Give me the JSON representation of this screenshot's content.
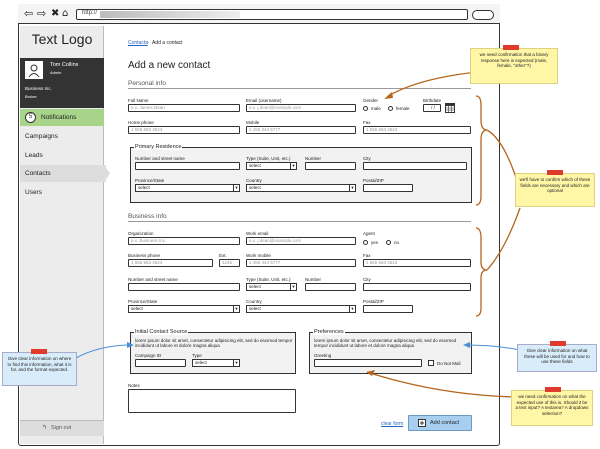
{
  "browser": {
    "url_prefix": "http://"
  },
  "sidebar": {
    "logo": "Text Logo",
    "user_name": "Tom Collins",
    "user_role": "Admin",
    "company": "Business Inc.",
    "company_role": "Broker",
    "notifications_count": "5",
    "notifications_label": "Notifications",
    "items": [
      "Campaigns",
      "Leads",
      "Contacts",
      "Users"
    ],
    "sign_out": "Sign out"
  },
  "breadcrumb": {
    "link": "Contacts",
    "current": "Add a contact"
  },
  "page_title": "Add a new contact",
  "personal": {
    "title": "Personal info",
    "full_name_label": "Full Name",
    "full_name_placeholder": "e.x. James Dean",
    "email_label": "Email (username)",
    "email_placeholder": "e.x. j.dean@example.com",
    "gender_label": "Gender",
    "gender_male": "male",
    "gender_female": "female",
    "birthdate_label": "Birthdate",
    "birthdate_value": "/ /",
    "home_phone_label": "Home phone",
    "home_phone_placeholder": "1 555 663 4524",
    "mobile_label": "Mobile",
    "mobile_placeholder": "1 456 344 5777",
    "fax_label": "Fax",
    "fax_placeholder": "1 555 663 4524"
  },
  "residence": {
    "title": "Primary Residence",
    "street_label": "Number and street name",
    "type_label": "Type (Suite, Unit, etc.)",
    "type_value": "select",
    "number_label": "Number",
    "city_label": "City",
    "province_label": "Province/State",
    "province_value": "select",
    "country_label": "Country",
    "country_value": "select",
    "postal_label": "Postal/ZIP"
  },
  "business": {
    "title": "Business info",
    "org_label": "Organization",
    "org_placeholder": "e.x. Business Inc.",
    "work_email_label": "Work email",
    "work_email_placeholder": "e.x. j.dean@example.com",
    "agent_label": "Agent",
    "agent_yes": "yes",
    "agent_no": "no",
    "bphone_label": "Business phone",
    "bphone_placeholder": "1 555 663 4524",
    "ext_label": "Ext.",
    "ext_placeholder": "1245",
    "work_mobile_label": "Work mobile",
    "work_mobile_placeholder": "1 456 344 5777",
    "fax_label": "Fax",
    "fax_placeholder": "1 555 663 4524",
    "street_label": "Number and street name",
    "type_label": "Type (Suite, Unit, etc.)",
    "type_value": "select",
    "number_label": "Number",
    "city_label": "City",
    "province_label": "Province/State",
    "province_value": "select",
    "country_label": "Country",
    "country_value": "select",
    "postal_label": "Postal/ZIP"
  },
  "source": {
    "title": "Initial Contact Source",
    "desc": "lorem ipsum dolor sit amet, consectetur adipisicing elit, sed do eiusmod tempor incididunt ut labore et dolore magna aliqua",
    "campaign_label": "Campaign ID",
    "type_label": "Type",
    "type_value": "select"
  },
  "preferences": {
    "title": "Preferences",
    "desc": "lorem ipsum dolor sit amet, consectetur adipisicing elit, sed do eiusmod tempor incididunt ut labore et dolore magna aliqua",
    "greeting_label": "Greeting",
    "do_not_mail": "Do Not Mail"
  },
  "notes_label": "Notes",
  "actions": {
    "clear": "clear form",
    "add": "Add contact"
  },
  "annotations": {
    "gender": "we need confirmation that a binary response here is expected (male, female, \"other\"?)",
    "fields": "we'll have to confirm which of these fields are necessary and which are optional",
    "source": "Give clear information on where to find this information, what it is for, and the format expected.",
    "preferences": "Give clear information on what these will be used for and how to use these fields",
    "greeting": "we need confirmation on what the expected use of this is. Should it be a text input? A textarea? A dropdown selection?"
  },
  "colors": {
    "notifications_bg": "#a8d48a",
    "sticky_yellow": "#fff6a6",
    "sticky_blue": "#d8ecfa",
    "pin_red": "#e03a2c",
    "annotation_line": "#b5651d"
  }
}
